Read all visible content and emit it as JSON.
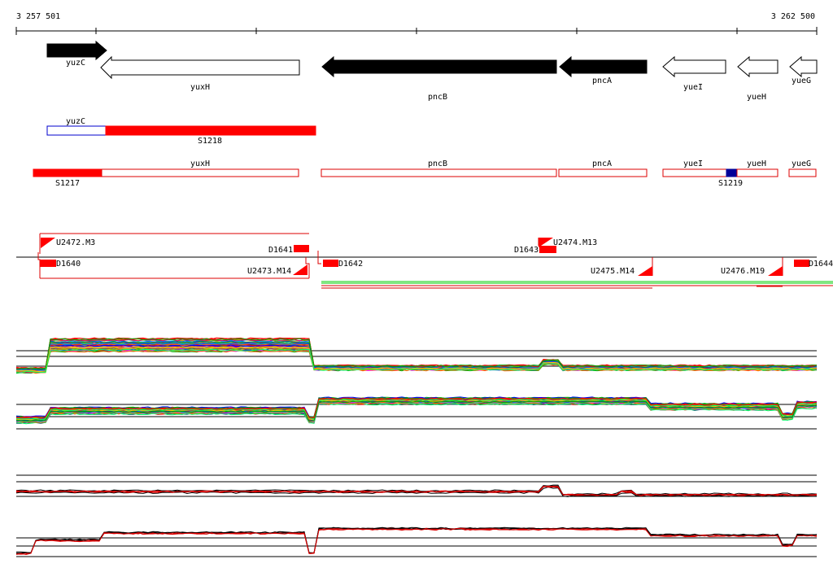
{
  "ruler": {
    "start_label": "3 257 501",
    "end_label": "3 262 500"
  },
  "genes": {
    "yuzC": "yuzC",
    "yuxH": "yuxH",
    "pncB": "pncB",
    "pncA": "pncA",
    "yueI": "yueI",
    "yueH": "yueH",
    "yueG": "yueG"
  },
  "segments": {
    "yuzC": "yuzC",
    "S1218": "S1218",
    "yuxH": "yuxH",
    "S1217": "S1217",
    "pncB": "pncB",
    "pncA": "pncA",
    "yueI": "yueI",
    "yueH": "yueH",
    "S1219": "S1219",
    "yueG": "yueG"
  },
  "features": {
    "U2472": "U2472.M3",
    "D1641": "D1641",
    "D1640": "D1640",
    "U2473": "U2473.M14",
    "D1643": "D1643",
    "U2474": "U2474.M13",
    "D1642": "D1642",
    "U2475": "U2475.M14",
    "U2476": "U2476.M19",
    "D1644": "D1644"
  },
  "colors": {
    "gene_fill": "#000000",
    "segment_red": "#ff0000",
    "segment_blue": "#000099",
    "outline_blue": "#0000cc",
    "green": "#00cc00",
    "red_line": "#dd0000"
  }
}
